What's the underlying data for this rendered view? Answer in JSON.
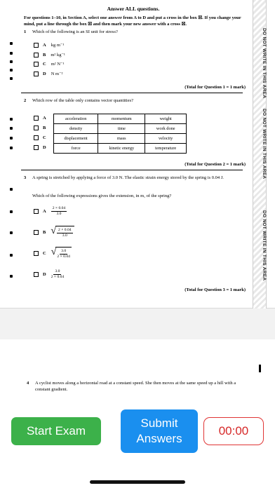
{
  "exam_page": {
    "heading": "Answer ALL questions.",
    "instructions": "For questions 1–10, in Section A, select one answer from A to D and put a cross in the box ☒. If you change your mind, put a line through the box ☒ and then mark your new answer with a cross ☒.",
    "side_warning": "DO NOT WRITE IN THIS AREA",
    "questions": [
      {
        "number": "1",
        "text": "Which of the following is an SI unit for stress?",
        "options": [
          {
            "letter": "A",
            "text": "kg m⁻¹"
          },
          {
            "letter": "B",
            "text": "m² kg⁻¹"
          },
          {
            "letter": "C",
            "text": "m² N⁻¹"
          },
          {
            "letter": "D",
            "text": "N m⁻²"
          }
        ],
        "total": "(Total for Question 1 = 1 mark)"
      },
      {
        "number": "2",
        "text": "Which row of the table only contains vector quantities?",
        "table": [
          {
            "letter": "A",
            "cells": [
              "acceleration",
              "momentum",
              "weight"
            ]
          },
          {
            "letter": "B",
            "cells": [
              "density",
              "time",
              "work done"
            ]
          },
          {
            "letter": "C",
            "cells": [
              "displacement",
              "mass",
              "velocity"
            ]
          },
          {
            "letter": "D",
            "cells": [
              "force",
              "kinetic energy",
              "temperature"
            ]
          }
        ],
        "total": "(Total for Question 2 = 1 mark)"
      },
      {
        "number": "3",
        "text": "A spring is stretched by applying a force of 3.0 N. The elastic strain energy stored by the spring is 0.04 J.",
        "prompt": "Which of the following expressions gives the extension, in m, of the spring?",
        "options": [
          {
            "letter": "A",
            "numerator": "2 × 0.04",
            "denominator": "3.0",
            "sqrt": false
          },
          {
            "letter": "B",
            "numerator": "2 × 0.04",
            "denominator": "3.0",
            "sqrt": true
          },
          {
            "letter": "C",
            "numerator": "3.0",
            "denominator": "2 × 0.04",
            "sqrt": true
          },
          {
            "letter": "D",
            "numerator": "3.0",
            "denominator": "2 × 0.04",
            "sqrt": false
          }
        ],
        "total": "(Total for Question 3 = 1 mark)"
      }
    ]
  },
  "next_page": {
    "number": "4",
    "text": "A cyclist moves along a horizontal road at a constant speed. She then moves at the same speed up a hill with a constant gradient."
  },
  "controls": {
    "start_label": "Start Exam",
    "submit_label": "Submit Answers",
    "timer": "00:00"
  },
  "colors": {
    "start": "#3cb14a",
    "submit": "#1a8fef",
    "timer": "#d62828"
  }
}
